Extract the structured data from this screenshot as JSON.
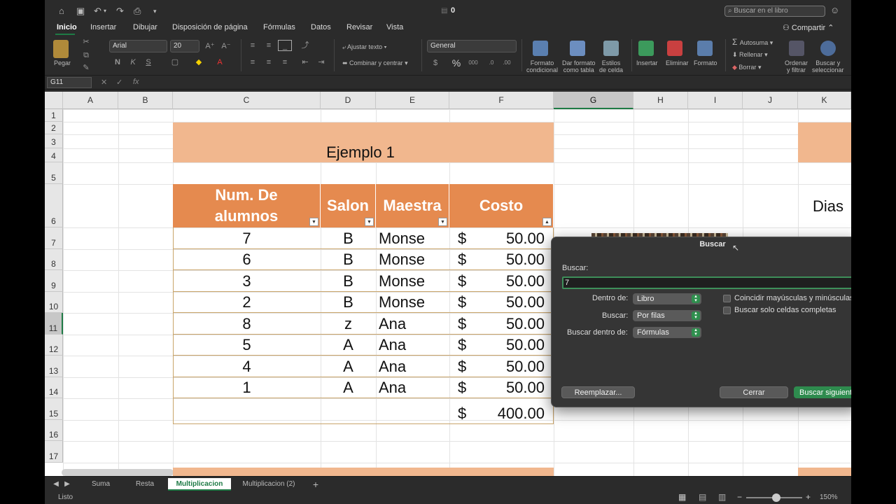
{
  "title": "0",
  "search_placeholder": "Buscar en el libro",
  "share": "Compartir",
  "tabs": [
    "Inicio",
    "Insertar",
    "Dibujar",
    "Disposición de página",
    "Fórmulas",
    "Datos",
    "Revisar",
    "Vista"
  ],
  "ribbon": {
    "paste": "Pegar",
    "font": "Arial",
    "size": "20",
    "wrap": "Ajustar texto",
    "merge": "Combinar y centrar",
    "number_format": "General",
    "cond_format": [
      "Formato",
      "condicional"
    ],
    "format_table": [
      "Dar formato",
      "como tabla"
    ],
    "cell_styles": [
      "Estilos",
      "de celda"
    ],
    "insert": "Insertar",
    "delete": "Eliminar",
    "format": "Formato",
    "autosum": "Autosuma",
    "fill": "Rellenar",
    "clear": "Borrar",
    "sort": [
      "Ordenar",
      "y filtrar"
    ],
    "find": [
      "Buscar y",
      "seleccionar"
    ],
    "bold": "N",
    "italic": "K",
    "underline": "S"
  },
  "namebox": "G11",
  "fx": "fx",
  "columns": [
    "A",
    "B",
    "C",
    "D",
    "E",
    "F",
    "G",
    "H",
    "I",
    "J",
    "K"
  ],
  "rows": [
    "1",
    "2",
    "3",
    "4",
    "5",
    "6",
    "7",
    "8",
    "9",
    "10",
    "11",
    "12",
    "13",
    "14",
    "15",
    "16",
    "17"
  ],
  "sheet": {
    "title": "Ejemplo 1",
    "headers": [
      "Num. De alumnos",
      "Salon",
      "Maestra",
      "Costo"
    ],
    "data": [
      [
        "7",
        "B",
        "Monse",
        "$",
        "50.00"
      ],
      [
        "6",
        "B",
        "Monse",
        "$",
        "50.00"
      ],
      [
        "3",
        "B",
        "Monse",
        "$",
        "50.00"
      ],
      [
        "2",
        "B",
        "Monse",
        "$",
        "50.00"
      ],
      [
        "8",
        "z",
        "Ana",
        "$",
        "50.00"
      ],
      [
        "5",
        "A",
        "Ana",
        "$",
        "50.00"
      ],
      [
        "4",
        "A",
        "Ana",
        "$",
        "50.00"
      ],
      [
        "1",
        "A",
        "Ana",
        "$",
        "50.00"
      ]
    ],
    "total_symbol": "$",
    "total": "400.00",
    "side_label": "Dias"
  },
  "dialog": {
    "title": "Buscar",
    "find_label": "Buscar:",
    "find_value": "7",
    "within_label": "Dentro de:",
    "within_value": "Libro",
    "search_label": "Buscar:",
    "search_value": "Por filas",
    "lookin_label": "Buscar dentro de:",
    "lookin_value": "Fórmulas",
    "match_case": "Coincidir mayúsculas y minúsculas",
    "whole_cells": "Buscar solo celdas completas",
    "replace_btn": "Reemplazar...",
    "close_btn": "Cerrar",
    "next_btn": "Buscar siguiente"
  },
  "sheet_tabs": [
    "Suma",
    "Resta",
    "Multiplicacion",
    "Multiplicacion (2)"
  ],
  "active_sheet_tab": "Multiplicacion",
  "status": "Listo",
  "zoom": "150%"
}
